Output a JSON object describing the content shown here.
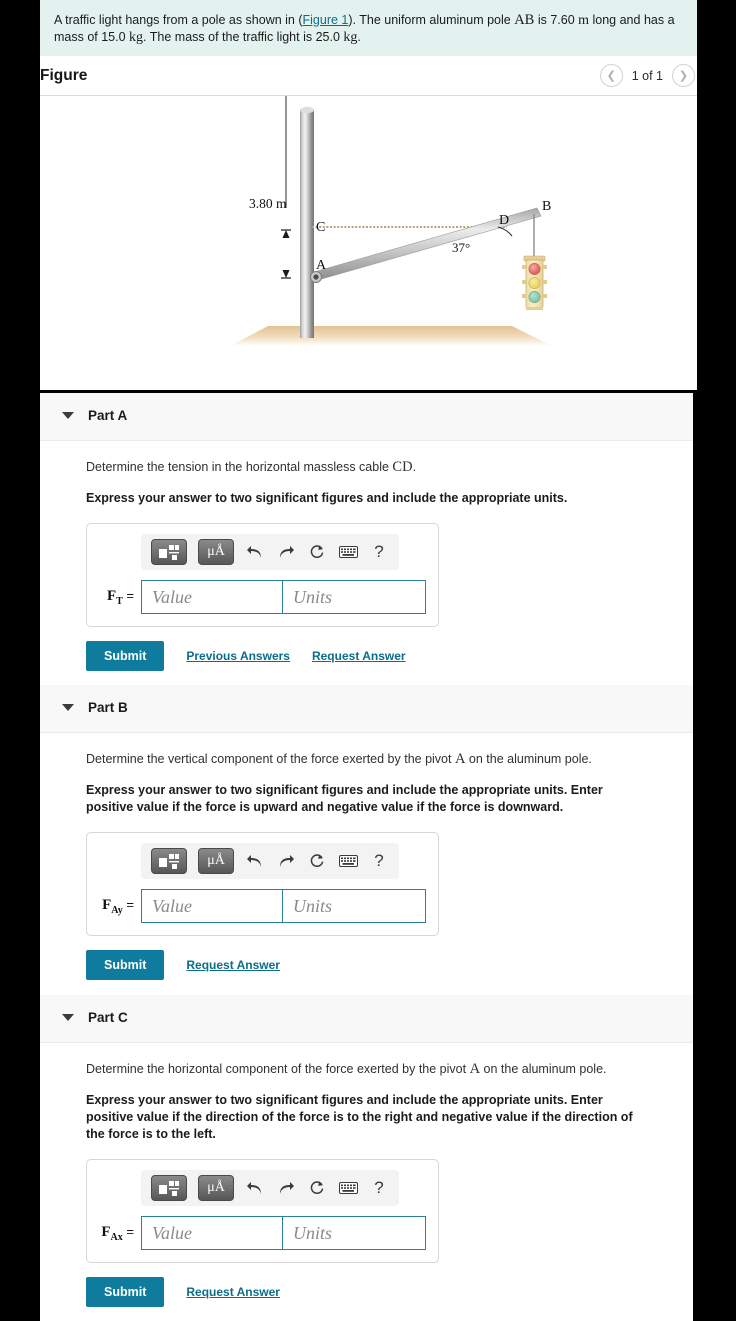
{
  "statement": {
    "text_a": "A traffic light hangs from a pole as shown in (",
    "figure_link": "Figure 1",
    "text_b": "). The uniform aluminum pole ",
    "pole_label": "AB",
    "text_c": " is 7.60 ",
    "unit_m": "m",
    "text_d": " long and has a mass of 15.0 ",
    "unit_kg1": "kg",
    "text_e": ". The mass of the traffic light is 25.0 ",
    "unit_kg2": "kg",
    "text_f": "."
  },
  "figure": {
    "title": "Figure",
    "pager_label": "1 of 1",
    "prev_icon": "chevron-left-icon",
    "next_icon": "chevron-right-icon",
    "diagram": {
      "labels": {
        "A": "A",
        "B": "B",
        "C": "C",
        "D": "D",
        "angle": "37°",
        "dimension": "3.80 m"
      },
      "colors": {
        "pole": "#b8b8b8",
        "ground": "#e7c99a",
        "cable": "#c9b48c",
        "light_body": "#f4e3ad",
        "light_red": "#e8746e",
        "light_yellow": "#f2dc6d",
        "light_green": "#8fcfb4"
      }
    }
  },
  "parts": [
    {
      "id": "part-a",
      "label": "Part A",
      "caret_icon": "caret-down-icon",
      "question": "Determine the tension in the horizontal massless cable ",
      "question_var": "CD",
      "question_end": ".",
      "instruction": "Express your answer to two significant figures and include the appropriate units.",
      "field_symbol": "F",
      "field_sub": "T",
      "field_eq": " =",
      "value_placeholder": "Value",
      "units_placeholder": "Units",
      "submit_label": "Submit",
      "links": [
        "Previous Answers",
        "Request Answer"
      ]
    },
    {
      "id": "part-b",
      "label": "Part B",
      "caret_icon": "caret-down-icon",
      "question": "Determine the vertical component of the force exerted by the pivot ",
      "question_var": "A",
      "question_end": " on the aluminum pole.",
      "instruction": "Express your answer to two significant figures and include the appropriate units. Enter positive value if the force is upward and negative value if the force is downward.",
      "field_symbol": "F",
      "field_sub": "Ay",
      "field_eq": " =",
      "value_placeholder": "Value",
      "units_placeholder": "Units",
      "submit_label": "Submit",
      "links": [
        "Request Answer"
      ]
    },
    {
      "id": "part-c",
      "label": "Part C",
      "caret_icon": "caret-down-icon",
      "question": "Determine the horizontal component of the force exerted by the pivot ",
      "question_var": "A",
      "question_end": " on the aluminum pole.",
      "instruction": "Express your answer to two significant figures and include the appropriate units. Enter positive value if the direction of the force is to the right and negative value if the direction of the force is to the left.",
      "field_symbol": "F",
      "field_sub": "Ax",
      "field_eq": " =",
      "value_placeholder": "Value",
      "units_placeholder": "Units",
      "submit_label": "Submit",
      "links": [
        "Request Answer"
      ]
    }
  ],
  "toolbar": {
    "template_icon": "math-template-icon",
    "units_icon": "micro-angstrom-icon",
    "units_text": "μÅ",
    "undo_icon": "undo-arrow-icon",
    "redo_icon": "redo-arrow-icon",
    "reset_icon": "reset-circle-icon",
    "keyboard_icon": "keyboard-icon",
    "help_icon": "help-question-icon",
    "help_text": "?"
  },
  "colors": {
    "accent": "#0f7c9e",
    "link": "#0a6e8a",
    "statement_bg": "#e4f2ef",
    "part_head_bg": "#f8f8f8"
  }
}
